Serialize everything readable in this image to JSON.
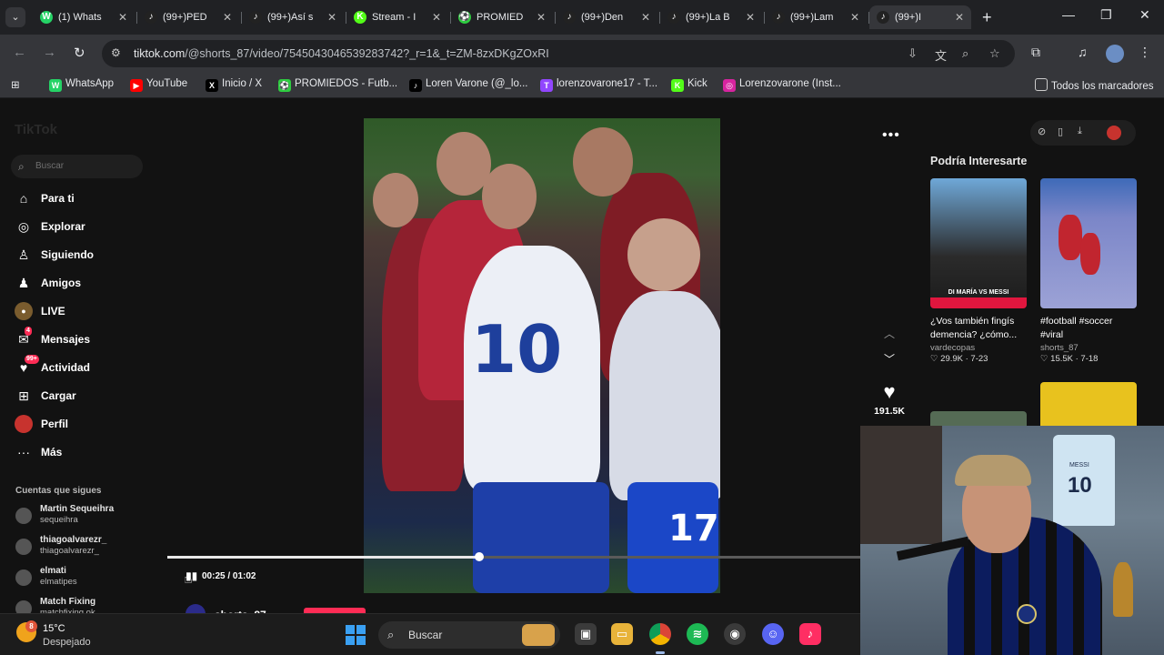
{
  "browser": {
    "tabs": [
      {
        "icon": "whatsapp-icon",
        "label": "(1) Whats",
        "color": "#25d366",
        "glyph": "W"
      },
      {
        "icon": "tiktok-icon",
        "label": "(99+)PED",
        "color": "#222",
        "glyph": "♪"
      },
      {
        "icon": "tiktok-icon",
        "label": "(99+)Así s",
        "color": "#222",
        "glyph": "♪"
      },
      {
        "icon": "kick-icon",
        "label": "Stream - I",
        "color": "#53fc18",
        "glyph": "K"
      },
      {
        "icon": "promiedos-icon",
        "label": "PROMIED",
        "color": "#2ecc40",
        "glyph": "⚽"
      },
      {
        "icon": "tiktok-icon",
        "label": "(99+)Den",
        "color": "#222",
        "glyph": "♪"
      },
      {
        "icon": "tiktok-icon",
        "label": "(99+)La B",
        "color": "#222",
        "glyph": "♪"
      },
      {
        "icon": "tiktok-icon",
        "label": "(99+)Lam",
        "color": "#222",
        "glyph": "♪"
      },
      {
        "icon": "tiktok-icon",
        "label": "(99+)I",
        "color": "#222",
        "glyph": "♪",
        "active": true
      }
    ],
    "url_host": "tiktok.com",
    "url_path": "/@shorts_87/video/7545043046539283742?_r=1&_t=ZM-8zxDKgZOxRI",
    "bookmarks": [
      {
        "icon": "whatsapp-icon",
        "label": "WhatsApp",
        "color": "#25d366",
        "glyph": "W"
      },
      {
        "icon": "youtube-icon",
        "label": "YouTube",
        "color": "#ff0000",
        "glyph": "▶"
      },
      {
        "icon": "x-icon",
        "label": "Inicio / X",
        "color": "#000",
        "glyph": "X"
      },
      {
        "icon": "promiedos-icon",
        "label": "PROMIEDOS - Futb...",
        "color": "#2ecc40",
        "glyph": "⚽"
      },
      {
        "icon": "tiktok-icon",
        "label": "Loren Varone (@_lo...",
        "color": "#000",
        "glyph": "♪"
      },
      {
        "icon": "twitch-icon",
        "label": "lorenzovarone17 - T...",
        "color": "#9146ff",
        "glyph": "T"
      },
      {
        "icon": "kick-icon",
        "label": "Kick",
        "color": "#53fc18",
        "glyph": "K"
      },
      {
        "icon": "instagram-icon",
        "label": "Lorenzovarone (Inst...",
        "color": "#d6249f",
        "glyph": "◎"
      }
    ],
    "all_bookmarks": "Todos los marcadores"
  },
  "sidebar": {
    "logo": "TikTok",
    "search_placeholder": "Buscar",
    "nav": [
      {
        "icon": "home-icon",
        "label": "Para ti",
        "glyph": "⌂"
      },
      {
        "icon": "compass-icon",
        "label": "Explorar",
        "glyph": "◎"
      },
      {
        "icon": "following-icon",
        "label": "Siguiendo",
        "glyph": "♙"
      },
      {
        "icon": "friends-icon",
        "label": "Amigos",
        "glyph": "♟"
      },
      {
        "icon": "live-icon",
        "label": "LIVE",
        "glyph": "●"
      },
      {
        "icon": "messages-icon",
        "label": "Mensajes",
        "glyph": "✉",
        "badge": "4"
      },
      {
        "icon": "activity-icon",
        "label": "Actividad",
        "glyph": "♥",
        "badge": "99+"
      },
      {
        "icon": "upload-icon",
        "label": "Cargar",
        "glyph": "⊞"
      },
      {
        "icon": "profile-icon",
        "label": "Perfil",
        "glyph": "●"
      },
      {
        "icon": "more-icon",
        "label": "Más",
        "glyph": "···"
      }
    ],
    "following_title": "Cuentas que sigues",
    "following": [
      {
        "name": "Martin Sequeihra",
        "user": "sequeihra"
      },
      {
        "name": "thiagoalvarezr_",
        "user": "thiagoalvarezr_"
      },
      {
        "name": "elmati",
        "user": "elmatipes"
      },
      {
        "name": "Match Fixing",
        "user": "matchfixing.ok"
      }
    ]
  },
  "video": {
    "time": "00:25 / 01:02",
    "progress": 0.45,
    "author": "shorts_87",
    "likes": "191.5K"
  },
  "right_panel": {
    "title": "Podría Interesarte",
    "cards": [
      {
        "desc": "¿Vos también fingís demencia? ¿cómo...",
        "user": "vardecopas",
        "stat": "♡ 29.9K · 7-23",
        "thumb_text": "DI MARÍA VS MESSI"
      },
      {
        "desc": "#football #soccer #viral",
        "user": "shorts_87",
        "stat": "♡ 15.5K · 7-18",
        "thumb_text": ""
      }
    ]
  },
  "taskbar": {
    "temp": "15°C",
    "weather": "Despejado",
    "weather_badge": "8",
    "search_placeholder": "Buscar"
  },
  "webcam": {
    "shirt_name": "MESSI",
    "shirt_number": "10"
  }
}
